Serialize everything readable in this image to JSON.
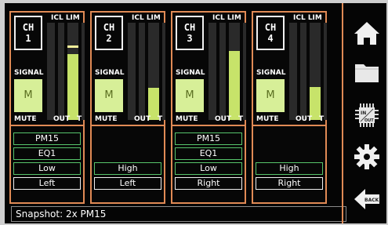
{
  "channels": [
    {
      "ch_line1": "CH",
      "ch_line2": "1",
      "lim_label": "ICL LIM",
      "signal_label": "SIGNAL",
      "signal_value": "M",
      "mute_label": "MUTE",
      "out_label": "OUT",
      "t_label": "T",
      "out_level": 0.68,
      "out_peak": 0.74,
      "functions": [
        "PM15",
        "EQ1",
        "Low",
        "Left"
      ]
    },
    {
      "ch_line1": "CH",
      "ch_line2": "2",
      "lim_label": "ICL LIM",
      "signal_label": "SIGNAL",
      "signal_value": "M",
      "mute_label": "MUTE",
      "out_label": "OUT",
      "t_label": "T",
      "out_level": 0.33,
      "out_peak": 0.33,
      "functions": [
        "",
        "",
        "High",
        "Left"
      ]
    },
    {
      "ch_line1": "CH",
      "ch_line2": "3",
      "lim_label": "ICL LIM",
      "signal_label": "SIGNAL",
      "signal_value": "M",
      "mute_label": "MUTE",
      "out_label": "OUT",
      "t_label": "T",
      "out_level": 0.71,
      "out_peak": 0.71,
      "functions": [
        "PM15",
        "EQ1",
        "Low",
        "Right"
      ]
    },
    {
      "ch_line1": "CH",
      "ch_line2": "4",
      "lim_label": "ICL LIM",
      "signal_label": "SIGNAL",
      "signal_value": "M",
      "mute_label": "MUTE",
      "out_label": "OUT",
      "t_label": "T",
      "out_level": 0.34,
      "out_peak": 0.34,
      "functions": [
        "",
        "",
        "High",
        "Right"
      ]
    }
  ],
  "status": {
    "text": "Snapshot: 2x PM15"
  },
  "sidebar": {
    "icons": [
      "home-icon",
      "folder-icon",
      "in-out-chip-icon",
      "gear-icon",
      "back-arrow-icon"
    ],
    "back_label": "BACK",
    "chip_in_label": "IN",
    "chip_out_label": "OUT"
  },
  "colors": {
    "accent": "#e08a55",
    "meter_fill": "#c7e36a",
    "signal_fill": "#d7ef98",
    "function_border_green": "#57c46b"
  }
}
